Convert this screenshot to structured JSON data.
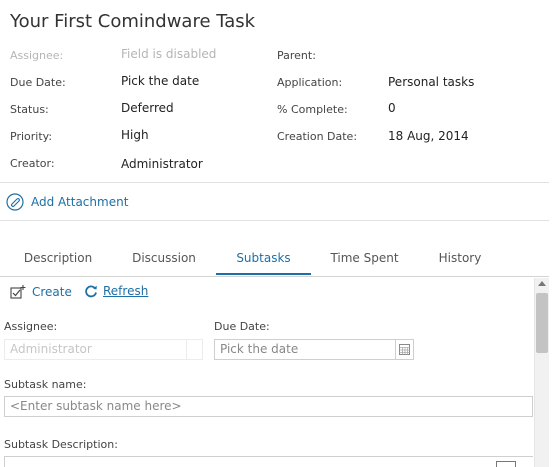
{
  "task": {
    "title": "Your First Comindware Task"
  },
  "fields_left": [
    {
      "label": "Assignee:",
      "value": "Field is disabled"
    },
    {
      "label": "Due Date:",
      "value": "Pick the date"
    },
    {
      "label": "Status:",
      "value": "Deferred"
    },
    {
      "label": "Priority:",
      "value": "High"
    },
    {
      "label": "Creator:",
      "value": "Administrator"
    }
  ],
  "fields_right": [
    {
      "label": "Parent:",
      "value": ""
    },
    {
      "label": "Application:",
      "value": "Personal tasks"
    },
    {
      "label": "% Complete:",
      "value": "0"
    },
    {
      "label": "Creation Date:",
      "value": "18 Aug, 2014"
    }
  ],
  "attachment": {
    "label": "Add Attachment",
    "icon": "paperclip-icon"
  },
  "tabs": [
    {
      "label": "Description",
      "active": false
    },
    {
      "label": "Discussion",
      "active": false
    },
    {
      "label": "Subtasks",
      "active": true
    },
    {
      "label": "Time Spent",
      "active": false
    },
    {
      "label": "History",
      "active": false
    }
  ],
  "subtasks": {
    "create_label": "Create",
    "refresh_label": "Refresh",
    "assignee_label": "Assignee:",
    "assignee_value": "Administrator",
    "due_date_label": "Due Date:",
    "due_date_placeholder": "Pick the date",
    "name_label": "Subtask name:",
    "name_placeholder": "<Enter subtask name here>",
    "description_label": "Subtask Description:"
  },
  "colors": {
    "accent": "#1d6fa5",
    "disabled_text": "#b5b5b5",
    "border": "#cfcfcf"
  }
}
